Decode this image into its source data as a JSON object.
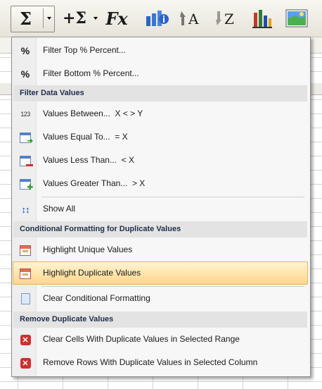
{
  "toolbar": {
    "sum_glyph": "Σ",
    "sum_plus_glyph": "+Σ",
    "fx_glyph": "Fx",
    "icons": [
      "autosum-icon",
      "autosum-plus-icon",
      "function-icon",
      "info-icon",
      "sort-ascending-icon",
      "sort-descending-icon",
      "bar-chart-icon",
      "image-icon"
    ]
  },
  "menu": {
    "top_items": [
      {
        "label": "Filter Top % Percent...",
        "icon": "percent-icon"
      },
      {
        "label": "Filter Bottom % Percent...",
        "icon": "percent-icon"
      }
    ],
    "section_filter": "Filter Data Values",
    "filter_items": [
      {
        "label": "Values Between...  X < > Y",
        "icon": "number-123-icon"
      },
      {
        "label": "Values Equal To...  = X",
        "icon": "window-arrow-icon"
      },
      {
        "label": "Values Less Than...  < X",
        "icon": "window-minus-icon"
      },
      {
        "label": "Values Greater Than...  > X",
        "icon": "window-plus-icon"
      }
    ],
    "show_all": {
      "label": "Show All",
      "icon": "show-all-icon"
    },
    "section_conditional": "Conditional Formatting for Duplicate Values",
    "conditional_items": [
      {
        "label": "Highlight Unique Values",
        "icon": "calendar-icon"
      },
      {
        "label": "Highlight Duplicate Values",
        "icon": "calendar-icon",
        "highlighted": true
      }
    ],
    "clear_item": {
      "label": "Clear Conditional Formatting",
      "icon": "page-icon"
    },
    "section_remove": "Remove Duplicate Values",
    "remove_items": [
      {
        "label": "Clear Cells With Duplicate Values in Selected Range",
        "icon": "red-x-icon"
      },
      {
        "label": "Remove Rows With Duplicate Values in Selected Column",
        "icon": "red-x-icon"
      }
    ]
  },
  "colors": {
    "highlight": "#ffd68a",
    "header_bg": "#e3e3e3",
    "header_text": "#1e2e4a",
    "accent_red": "#d02f2f"
  }
}
